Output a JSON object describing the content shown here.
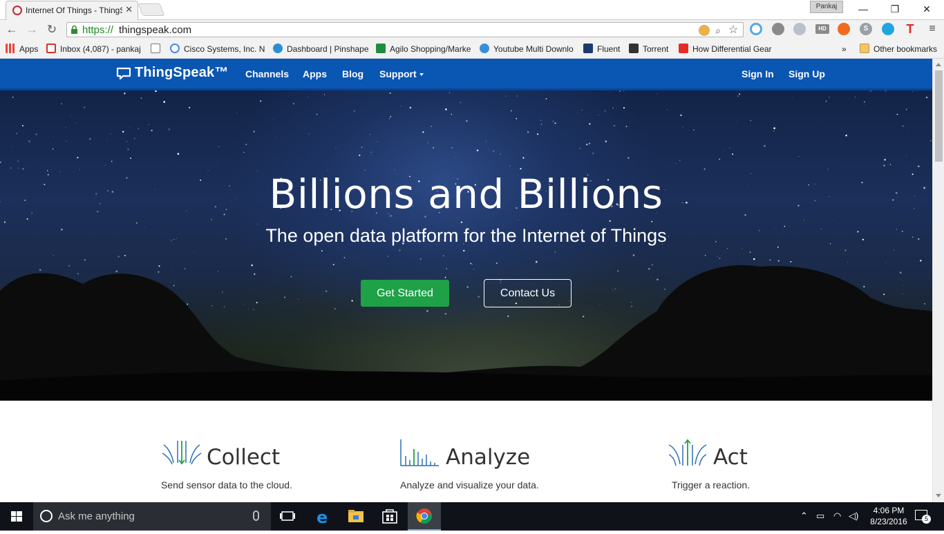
{
  "browser": {
    "tab_title": "Internet Of Things - ThingSpeak",
    "tab_close": "✕",
    "profile_name": "Pankaj",
    "window_controls": {
      "minimize": "—",
      "maximize": "❐",
      "close": "✕"
    },
    "url_scheme": "https://",
    "url_host": "thingspeak.com",
    "bookmarks": [
      {
        "label": "Apps",
        "icon": "apps-grid-icon",
        "color": "#e8453c"
      },
      {
        "label": "Inbox (4,087) - pankaj",
        "icon": "gmail-icon",
        "color": "#d93025"
      },
      {
        "label": "",
        "icon": "page-icon",
        "color": "#777777"
      },
      {
        "label": "Cisco Systems, Inc. Ne",
        "icon": "google-icon",
        "color": "#4285f4"
      },
      {
        "label": "Dashboard | Pinshape",
        "icon": "pinshape-icon",
        "color": "#2a8fd0"
      },
      {
        "label": "Agilo Shopping/Marke",
        "icon": "sheets-icon",
        "color": "#1e8e3e"
      },
      {
        "label": "Youtube Multi Downlo",
        "icon": "download-icon",
        "color": "#3b8fd8"
      },
      {
        "label": "Fluent",
        "icon": "fluent-icon",
        "color": "#1c3a6e"
      },
      {
        "label": "Torrent",
        "icon": "torrent-icon",
        "color": "#333333"
      },
      {
        "label": "How Differential Gear",
        "icon": "youtube-icon",
        "color": "#e52d27"
      }
    ],
    "bookmarks_overflow": "»",
    "other_bookmarks": "Other bookmarks"
  },
  "site": {
    "brand": "ThingSpeak™",
    "nav": [
      "Channels",
      "Apps",
      "Blog",
      "Support"
    ],
    "auth": {
      "sign_in": "Sign In",
      "sign_up": "Sign Up"
    },
    "hero": {
      "title": "Billions and Billions",
      "subtitle": "The open data platform for the Internet of Things",
      "cta_primary": "Get Started",
      "cta_secondary": "Contact Us"
    },
    "features": [
      {
        "title": "Collect",
        "desc": "Send sensor data to the cloud.",
        "icon": "collect-icon"
      },
      {
        "title": "Analyze",
        "desc": "Analyze and visualize your data.",
        "icon": "analyze-icon"
      },
      {
        "title": "Act",
        "desc": "Trigger a reaction.",
        "icon": "act-icon"
      }
    ],
    "colors": {
      "navbar": "#0a56b3",
      "cta": "#1ea147",
      "feature_icon": "#2a6fb8",
      "feature_accent": "#1ea147"
    }
  },
  "taskbar": {
    "search_placeholder": "Ask me anything",
    "time": "4:06 PM",
    "date": "8/23/2016",
    "notifications": "5"
  }
}
